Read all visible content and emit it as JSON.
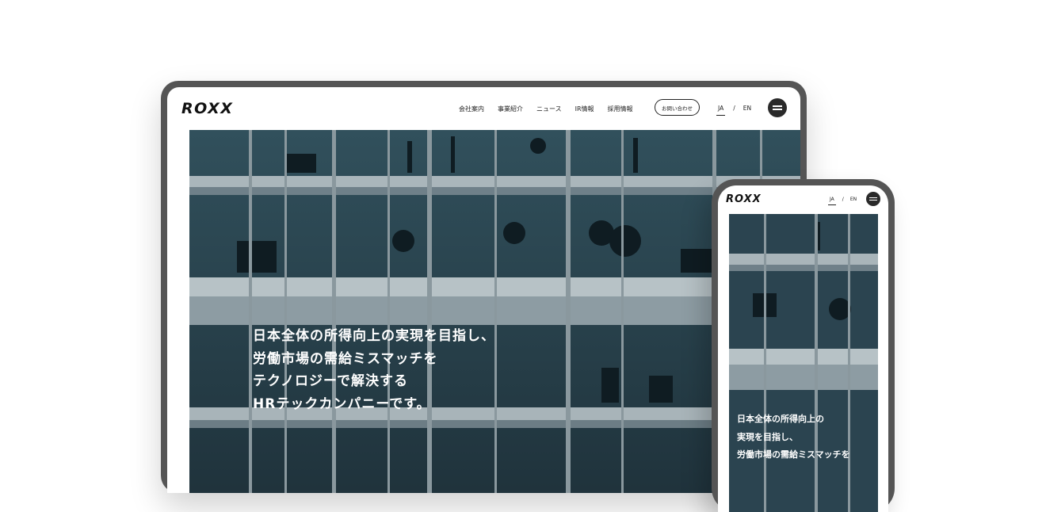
{
  "brand": {
    "logo_text": "ROXX"
  },
  "nav": {
    "items": [
      "会社案内",
      "事業紹介",
      "ニュース",
      "IR情報",
      "採用情報"
    ],
    "contact_label": "お問い合わせ"
  },
  "lang": {
    "ja": "JA",
    "separator": "/",
    "en": "EN",
    "active": "JA"
  },
  "hero": {
    "tablet_lines": [
      "日本全体の所得向上の実現を目指し、",
      "労働市場の需給ミスマッチを",
      "テクノロジーで解決する",
      "HRテックカンパニーです。"
    ],
    "phone_lines": [
      "日本全体の所得向上の",
      "実現を目指し、",
      "労働市場の需給ミスマッチを"
    ]
  },
  "colors": {
    "device_frame": "#555555",
    "hero_glass": "#2d4752",
    "hero_frame": "#b9c3c7",
    "text_dark": "#222222"
  },
  "icons": {
    "menu": "hamburger-icon"
  }
}
